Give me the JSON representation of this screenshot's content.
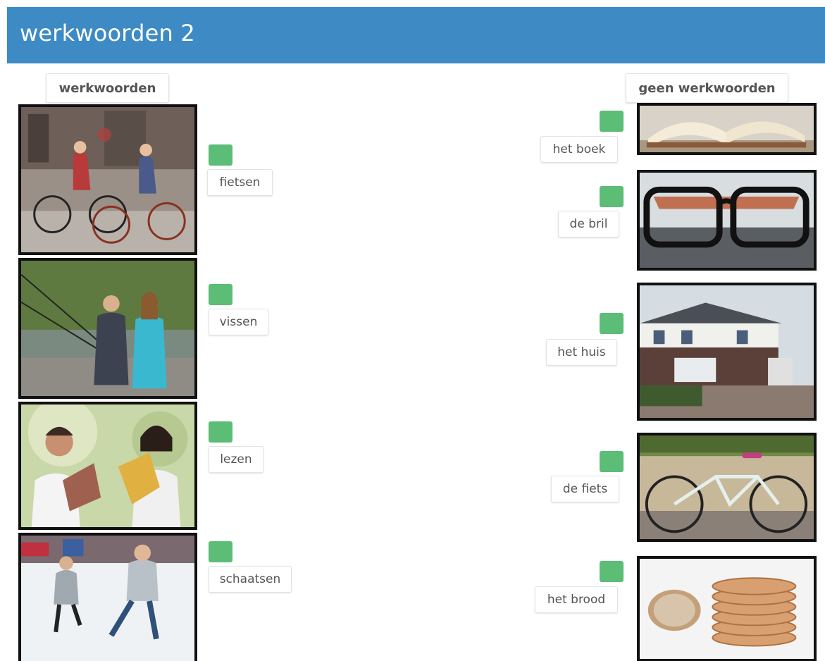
{
  "header": {
    "title": "werkwoorden 2"
  },
  "columns": {
    "left": {
      "title": "werkwoorden"
    },
    "right": {
      "title": "geen werkwoorden"
    }
  },
  "left_items": [
    {
      "label": "fietsen",
      "image": "cyclists-photo"
    },
    {
      "label": "vissen",
      "image": "fishing-photo"
    },
    {
      "label": "lezen",
      "image": "children-reading-photo"
    },
    {
      "label": "schaatsen",
      "image": "ice-skating-photo"
    }
  ],
  "right_items": [
    {
      "label": "het boek",
      "image": "open-book-photo"
    },
    {
      "label": "de bril",
      "image": "glasses-photo"
    },
    {
      "label": "het huis",
      "image": "house-photo"
    },
    {
      "label": "de fiets",
      "image": "bicycle-photo"
    },
    {
      "label": "het brood",
      "image": "bread-photo"
    }
  ],
  "colors": {
    "header": "#3d8ac4",
    "handle": "#5cbd77",
    "frame": "#111111"
  }
}
